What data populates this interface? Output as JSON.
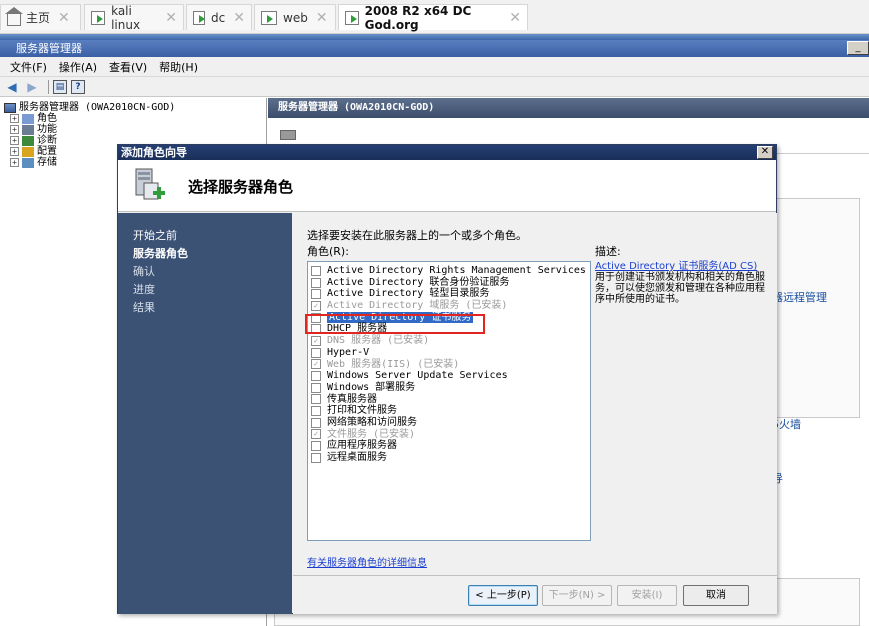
{
  "tabs": [
    {
      "label": "主页"
    },
    {
      "label": "kali linux"
    },
    {
      "label": "dc"
    },
    {
      "label": "web"
    },
    {
      "label": "2008 R2 x64 DC God.org"
    }
  ],
  "window": {
    "title": "服务器管理器",
    "menu": [
      "文件(F)",
      "操作(A)",
      "查看(V)",
      "帮助(H)"
    ]
  },
  "tree": {
    "root": "服务器管理器 (OWA2010CN-GOD)",
    "items": [
      "角色",
      "功能",
      "诊断",
      "配置",
      "存储"
    ]
  },
  "right_pane": {
    "header": "服务器管理器 (OWA2010CN-GOD)",
    "snippet1": "器远程管理",
    "snippet2": "5火墙",
    "snippet3": "导"
  },
  "dialog": {
    "title": "添加角色向导",
    "header": "选择服务器角色",
    "nav": [
      "开始之前",
      "服务器角色",
      "确认",
      "进度",
      "结果"
    ],
    "instruction": "选择要安装在此服务器上的一个或多个角色。",
    "roles_label": "角色(R):",
    "desc_label": "描述:",
    "desc_link": "Active Directory 证书服务(AD CS)",
    "desc_text": "用于创建证书颁发机构和相关的角色服务，可以使您颁发和管理在各种应用程序中所使用的证书。",
    "roles": [
      {
        "label": "Active Directory Rights Management Services",
        "checked": false,
        "disabled": false
      },
      {
        "label": "Active Directory 联合身份验证服务",
        "checked": false,
        "disabled": false
      },
      {
        "label": "Active Directory 轻型目录服务",
        "checked": false,
        "disabled": false
      },
      {
        "label": "Active Directory 域服务 (已安装)",
        "checked": true,
        "disabled": true
      },
      {
        "label": "Active Directory 证书服务",
        "checked": false,
        "disabled": false,
        "selected": true
      },
      {
        "label": "DHCP 服务器",
        "checked": false,
        "disabled": false
      },
      {
        "label": "DNS 服务器 (已安装)",
        "checked": true,
        "disabled": true
      },
      {
        "label": "Hyper-V",
        "checked": false,
        "disabled": false
      },
      {
        "label": "Web 服务器(IIS) (已安装)",
        "checked": true,
        "disabled": true
      },
      {
        "label": "Windows Server Update Services",
        "checked": false,
        "disabled": false
      },
      {
        "label": "Windows 部署服务",
        "checked": false,
        "disabled": false
      },
      {
        "label": "传真服务器",
        "checked": false,
        "disabled": false
      },
      {
        "label": "打印和文件服务",
        "checked": false,
        "disabled": false
      },
      {
        "label": "网络策略和访问服务",
        "checked": false,
        "disabled": false
      },
      {
        "label": "文件服务 (已安装)",
        "checked": true,
        "disabled": true
      },
      {
        "label": "应用程序服务器",
        "checked": false,
        "disabled": false
      },
      {
        "label": "远程桌面服务",
        "checked": false,
        "disabled": false
      }
    ],
    "more_info": "有关服务器角色的详细信息",
    "buttons": {
      "back": "< 上一步(P)",
      "next": "下一步(N) >",
      "install": "安装(I)",
      "cancel": "取消"
    }
  }
}
